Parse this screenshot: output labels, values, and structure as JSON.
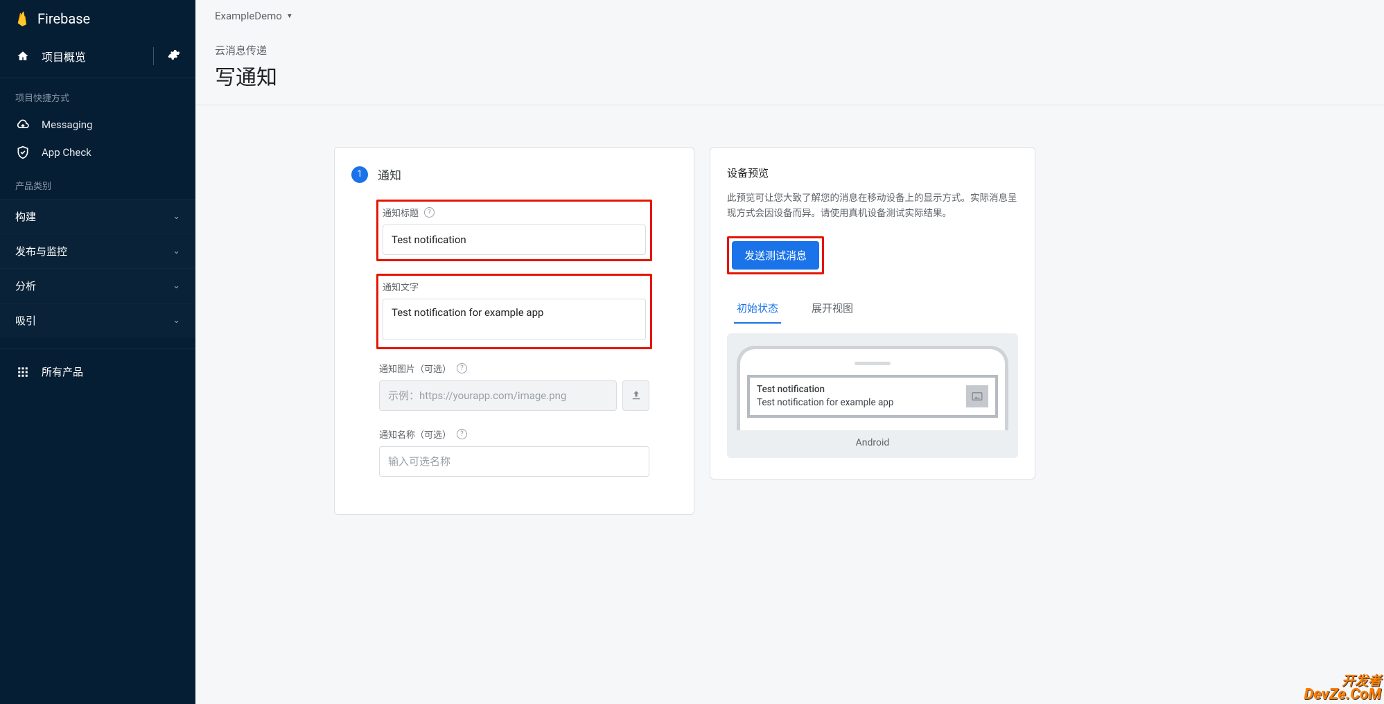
{
  "brand": "Firebase",
  "sidebar": {
    "overview": "项目概览",
    "section_shortcuts": "项目快捷方式",
    "shortcuts": [
      {
        "label": "Messaging"
      },
      {
        "label": "App Check"
      }
    ],
    "section_categories": "产品类别",
    "categories": [
      {
        "label": "构建"
      },
      {
        "label": "发布与监控"
      },
      {
        "label": "分析"
      },
      {
        "label": "吸引"
      }
    ],
    "all_products": "所有产品"
  },
  "header": {
    "project_name": "ExampleDemo",
    "breadcrumb_sub": "云消息传递",
    "title": "写通知"
  },
  "form": {
    "step_num": "1",
    "step_label": "通知",
    "title_label": "通知标题",
    "title_value": "Test notification",
    "text_label": "通知文字",
    "text_value": "Test notification for example app",
    "image_label": "通知图片（可选）",
    "image_placeholder": "示例：https://yourapp.com/image.png",
    "name_label": "通知名称（可选）",
    "name_placeholder": "输入可选名称"
  },
  "preview": {
    "panel_title": "设备预览",
    "desc": "此预览可让您大致了解您的消息在移动设备上的显示方式。实际消息呈现方式会因设备而异。请使用真机设备测试实际结果。",
    "send_btn": "发送测试消息",
    "tab_initial": "初始状态",
    "tab_expand": "展开视图",
    "notif_title": "Test notification",
    "notif_text": "Test notification for example app",
    "platform": "Android"
  },
  "watermark": {
    "cn": "开发者",
    "en": "DevZe.CoM"
  }
}
